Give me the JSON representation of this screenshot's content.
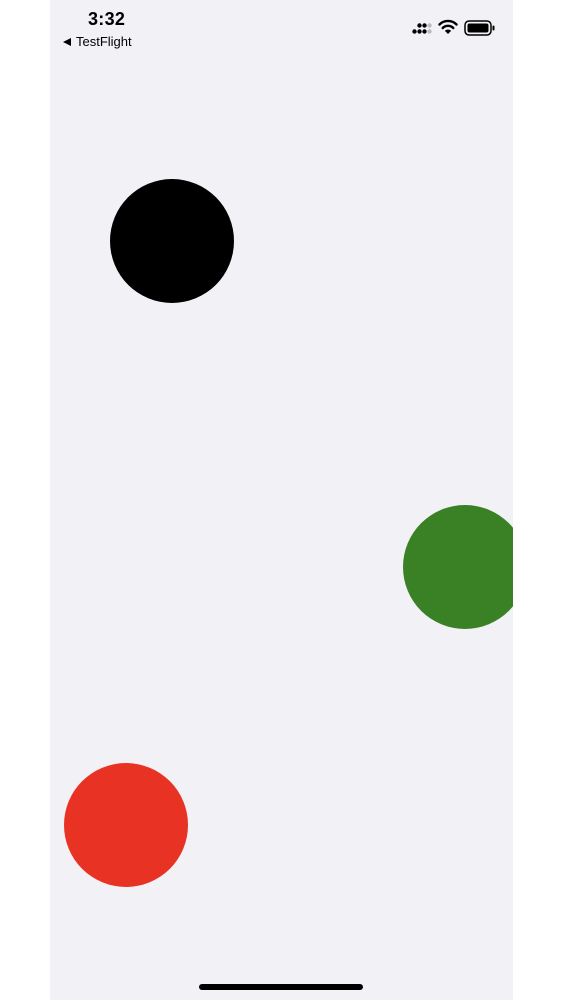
{
  "status_bar": {
    "time": "3:32",
    "back_label": "TestFlight",
    "icons": [
      "signal-icon",
      "wifi-icon",
      "battery-icon"
    ]
  },
  "canvas": {
    "background": "#f2f1f6",
    "circles": [
      {
        "name": "black-circle",
        "color": "#000000"
      },
      {
        "name": "green-circle",
        "color": "#3a8024"
      },
      {
        "name": "red-circle",
        "color": "#e83324"
      }
    ]
  }
}
